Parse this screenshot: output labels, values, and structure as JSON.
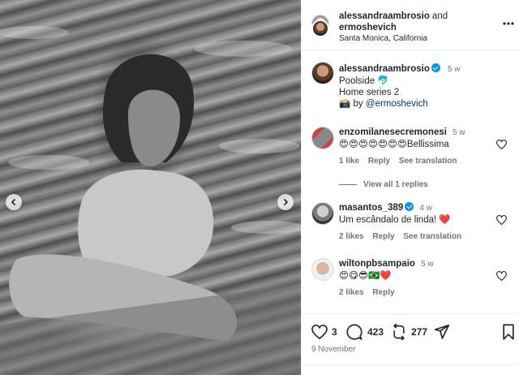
{
  "header": {
    "user1": "alessandraambrosio",
    "joiner": "and",
    "user2": "ermoshevich",
    "location": "Santa Monica, California"
  },
  "caption": {
    "username": "alessandraambrosio",
    "time": "5 w",
    "line1": "Poolside",
    "line1_emoji": "🐬",
    "line2": "Home series 2",
    "line3_emoji": "📸",
    "line3_prefix": "by",
    "line3_mention": "@ermoshevich"
  },
  "comments": [
    {
      "username": "enzomilanesecremonesi",
      "time": "5 w",
      "text": "😍😍😍😍😍😍😍Bellissima",
      "likes": "1 like",
      "reply": "Reply",
      "translate": "See translation",
      "view_replies": "View all 1 replies"
    },
    {
      "username": "masantos_389",
      "time": "4 w",
      "text": "Um escândalo de linda! ❤️",
      "likes": "2 likes",
      "reply": "Reply",
      "translate": "See translation"
    },
    {
      "username": "wiltonpbsampaio",
      "time": "5 w",
      "text": "😍😋😎🇧🇷❤️",
      "likes": "2 likes",
      "reply": "Reply"
    }
  ],
  "actions": {
    "likes_count": "3",
    "comments_count": "423",
    "reposts_count": "277",
    "date": "9 November"
  },
  "icons": {
    "carousel_prev": "chevron-left-icon",
    "carousel_next": "chevron-right-icon",
    "heart": "heart-icon",
    "comment": "comment-icon",
    "repost": "repost-icon",
    "share": "share-icon",
    "save": "bookmark-icon"
  },
  "colors": {
    "verified": "#0095f6",
    "mention": "#00376b",
    "muted": "#737373"
  }
}
